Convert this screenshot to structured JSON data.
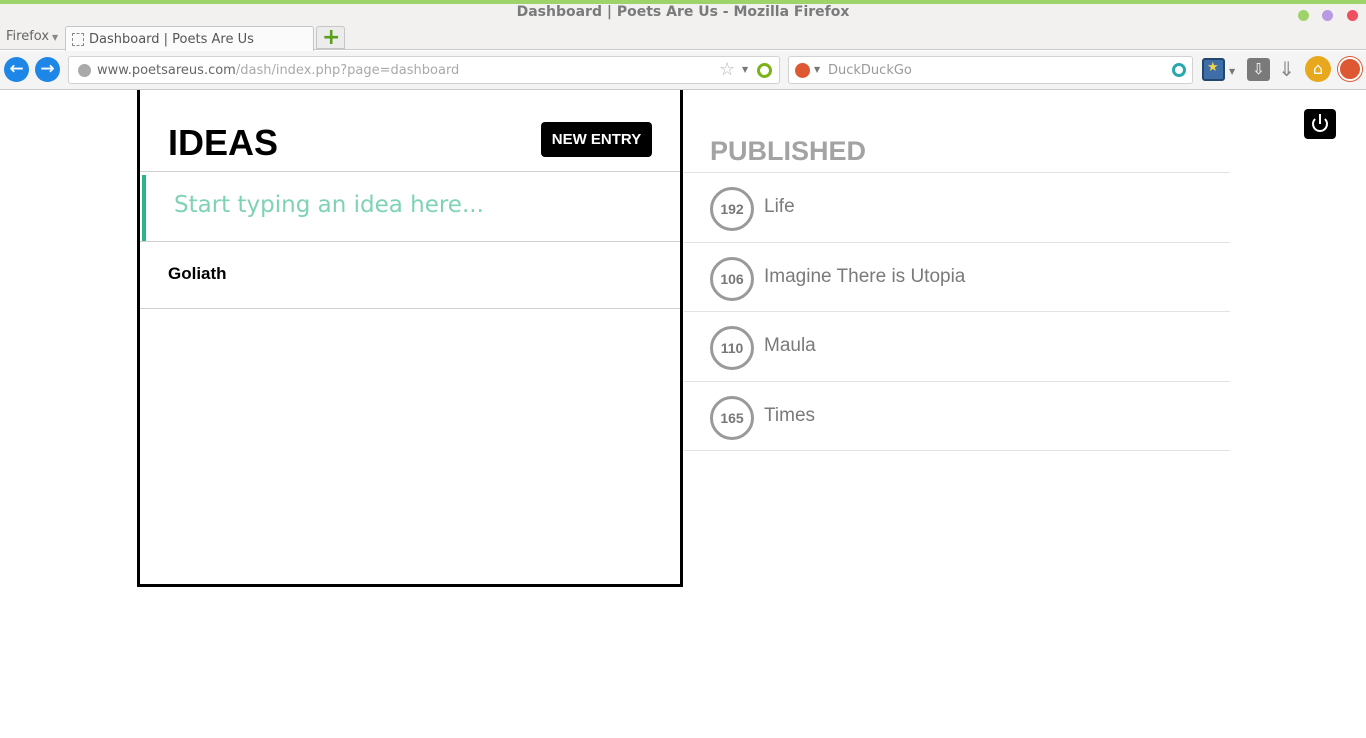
{
  "window": {
    "title": "Dashboard | Poets Are Us - Mozilla Firefox",
    "dots": [
      "#9ed36a",
      "#b899e2",
      "#ef4f5e"
    ]
  },
  "tabs": {
    "menu_label": "Firefox",
    "active_tab_title": "Dashboard | Poets Are Us"
  },
  "navbar": {
    "url_domain": "www.poetsareus.com",
    "url_path": "/dash/index.php?page=dashboard",
    "search_placeholder": "DuckDuckGo"
  },
  "ideas": {
    "title": "IDEAS",
    "new_entry_label": "NEW ENTRY",
    "input_placeholder": "Start typing an idea here...",
    "items": [
      {
        "title": "Goliath"
      }
    ]
  },
  "published": {
    "title": "PUBLISHED",
    "items": [
      {
        "count": "192",
        "title": "Life"
      },
      {
        "count": "106",
        "title": "Imagine There is Utopia"
      },
      {
        "count": "110",
        "title": "Maula"
      },
      {
        "count": "165",
        "title": "Times"
      }
    ]
  },
  "colors": {
    "accent": "#2bb58a",
    "badge_border": "#9a9a9a"
  }
}
